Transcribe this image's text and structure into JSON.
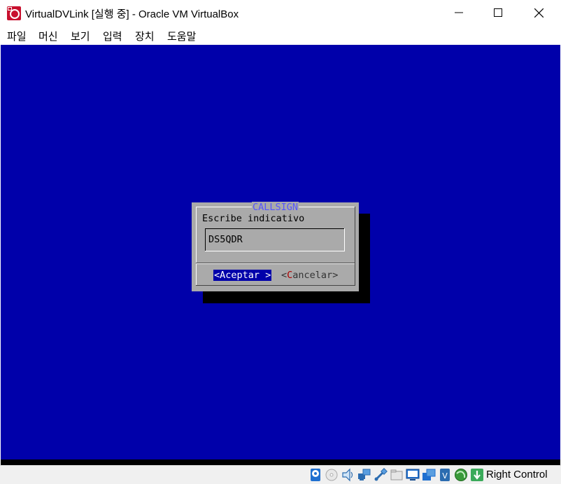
{
  "window": {
    "title": "VirtualDVLink [실행 중] - Oracle VM VirtualBox",
    "controls": {
      "minimize": "minimize",
      "maximize": "maximize",
      "close": "close"
    }
  },
  "menu": [
    "파일",
    "머신",
    "보기",
    "입력",
    "장치",
    "도움말"
  ],
  "vm": {
    "background_color": "#0000aa",
    "dialog": {
      "title": "CALLSIGN",
      "prompt": "Escribe indicativo",
      "input_value": "DS5QDR",
      "accept_button": {
        "left": "<",
        "hotkey": "A",
        "rest": "ceptar",
        "right": " >"
      },
      "cancel_button": {
        "left": "<",
        "hotkey": "C",
        "rest": "ancelar",
        "right": ">"
      }
    }
  },
  "statusbar": {
    "icons": [
      "hard-disk-icon",
      "optical-drive-icon",
      "audio-icon",
      "network-icon",
      "usb-icon",
      "shared-folders-icon",
      "display-icon",
      "video-capture-icon",
      "cpu-icon",
      "mouse-integration-icon",
      "keyboard-icon"
    ],
    "host_key": "Right Control"
  }
}
